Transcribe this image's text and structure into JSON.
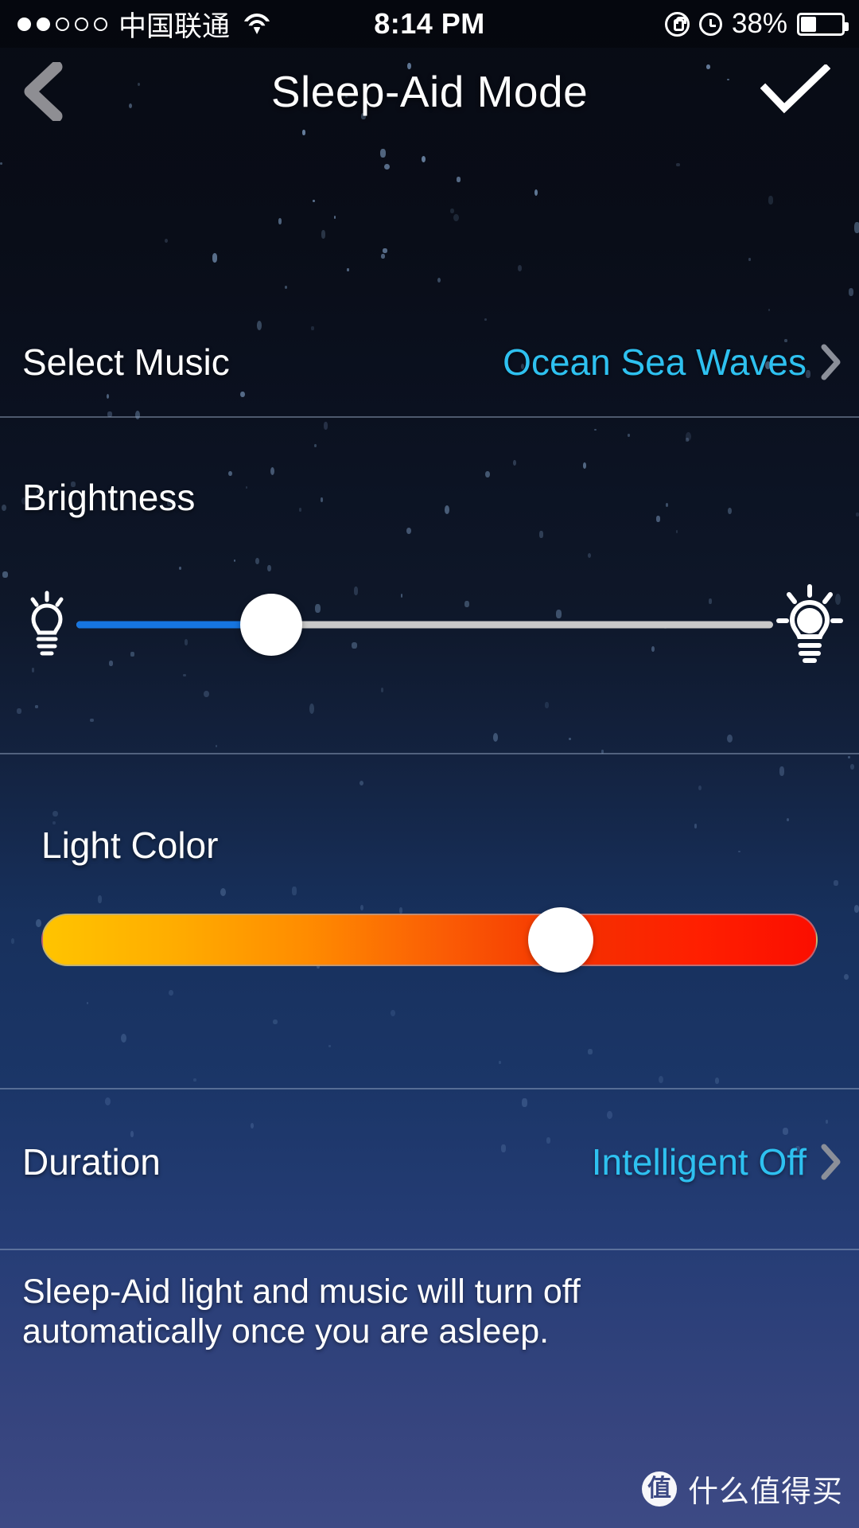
{
  "statusbar": {
    "signal_dots_filled": 2,
    "signal_dots_total": 5,
    "carrier": "中国联通",
    "wifi_icon": "wifi-icon",
    "time": "8:14 PM",
    "rotation_lock_icon": "rotation-lock-icon",
    "alarm_icon": "alarm-clock-icon",
    "battery_percent": "38%",
    "battery_level": 38
  },
  "navbar": {
    "back_icon": "back-chevron-icon",
    "title": "Sleep-Aid Mode",
    "confirm_icon": "checkmark-icon"
  },
  "select_music": {
    "label": "Select Music",
    "value": "Ocean Sea Waves",
    "chevron_icon": "chevron-right-icon"
  },
  "brightness": {
    "label": "Brightness",
    "min_icon": "dim-bulb-icon",
    "max_icon": "bright-bulb-icon",
    "value_percent": 28,
    "fill_color": "#1675e0",
    "track_color": "#c9c9c9",
    "thumb_color": "#ffffff"
  },
  "light_color": {
    "label": "Light Color",
    "value_percent": 67,
    "gradient_from": "#ffc400",
    "gradient_mid": "#ff7a00",
    "gradient_to": "#fb0e00",
    "thumb_color": "#ffffff"
  },
  "duration": {
    "label": "Duration",
    "value": "Intelligent Off",
    "chevron_icon": "chevron-right-icon"
  },
  "description": {
    "text": "Sleep-Aid light and music will turn off automatically once you are asleep."
  },
  "watermark": {
    "logo_char": "值",
    "text": "什么值得买"
  },
  "theme": {
    "accent_cyan": "#2ec1f0",
    "blue_fill": "#1675e0",
    "text_white": "#ffffff"
  }
}
